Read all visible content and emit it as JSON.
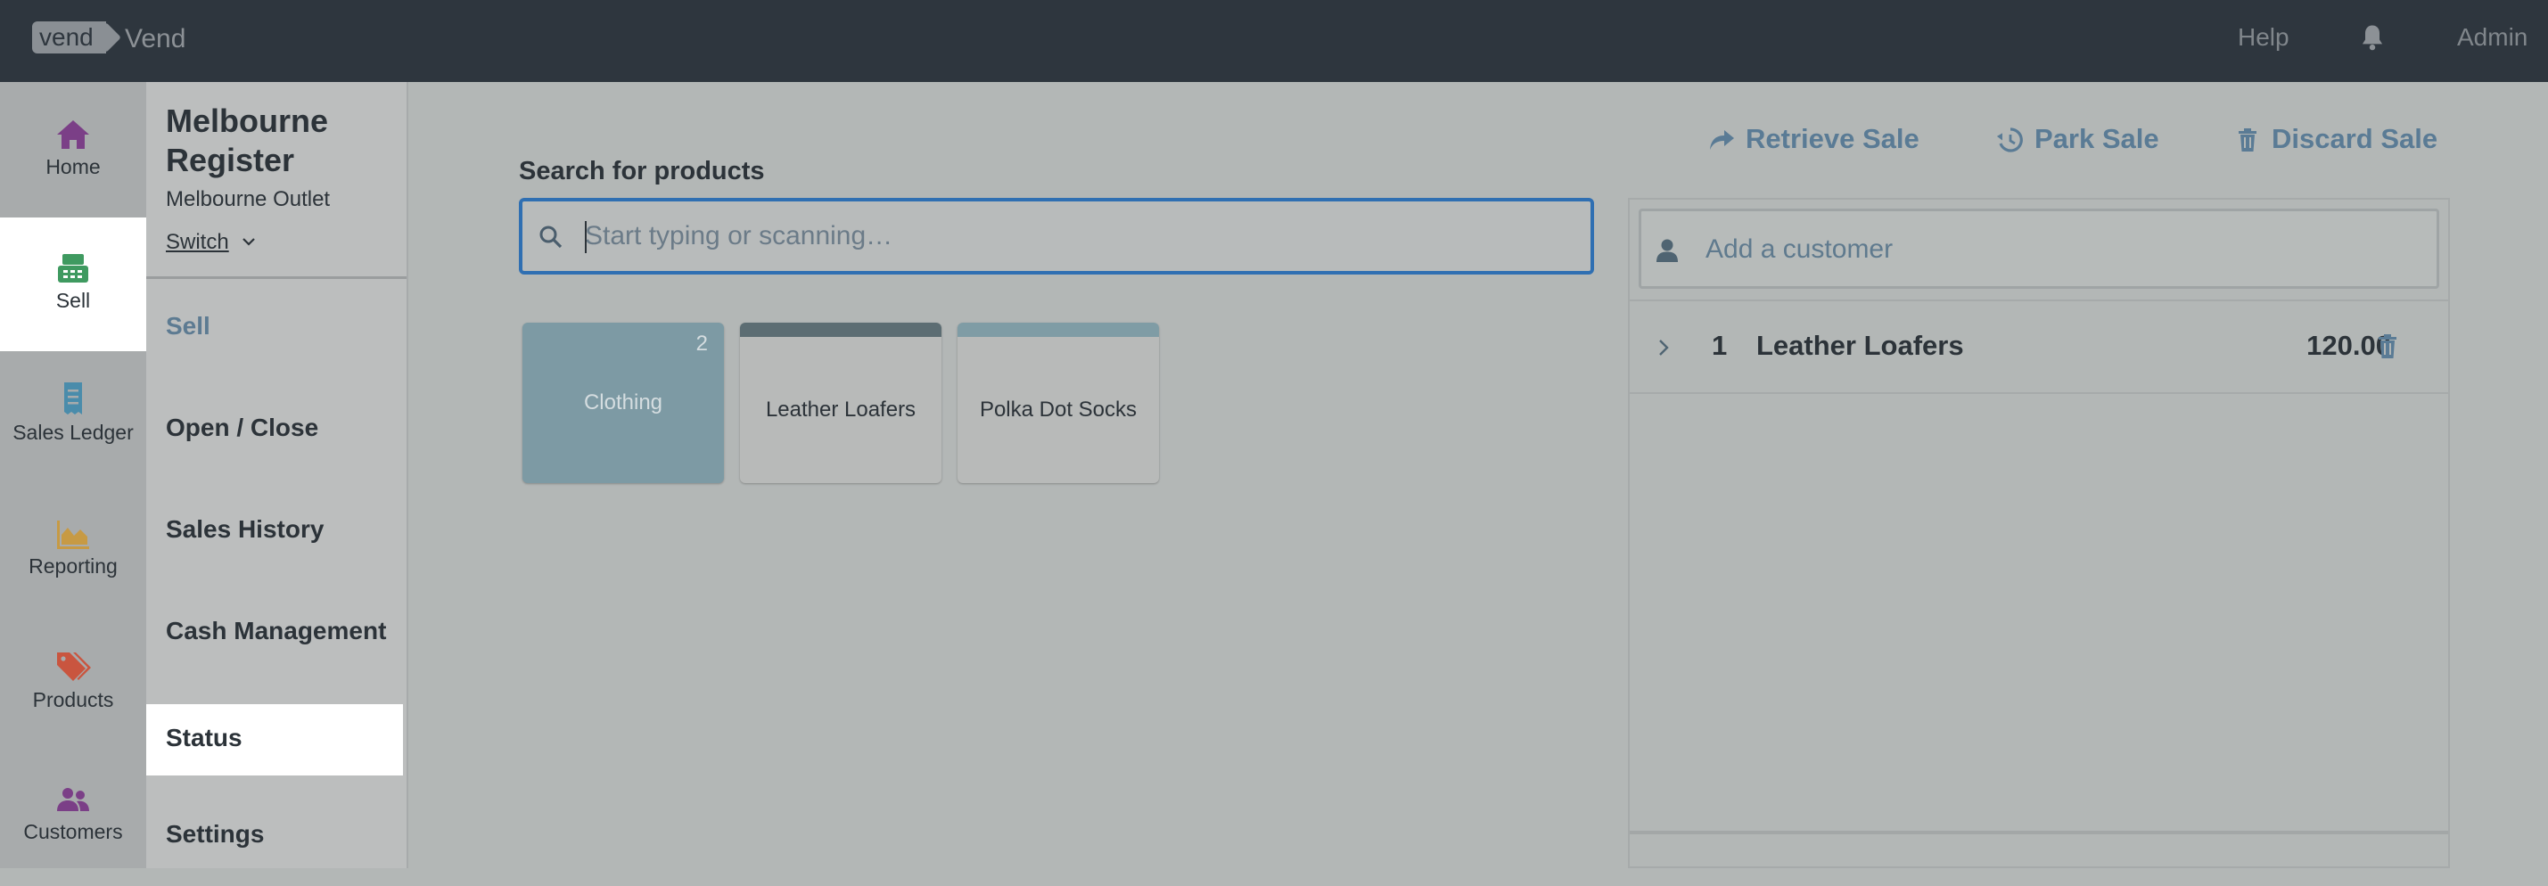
{
  "topbar": {
    "logo_text": "vend",
    "app_name": "Vend",
    "help": "Help",
    "user": "Admin",
    "bell_icon": "bell-icon"
  },
  "leftnav": {
    "items": [
      {
        "label": "Home",
        "icon": "home-icon",
        "color": "#7b3f87"
      },
      {
        "label": "Sell",
        "icon": "register-icon",
        "color": "#3f9a60",
        "active": true
      },
      {
        "label": "Sales Ledger",
        "icon": "receipt-icon",
        "color": "#4a8cab"
      },
      {
        "label": "Reporting",
        "icon": "area-chart-icon",
        "color": "#c79a44"
      },
      {
        "label": "Products",
        "icon": "tags-icon",
        "color": "#c9553f"
      },
      {
        "label": "Customers",
        "icon": "users-icon",
        "color": "#7b3f87"
      }
    ]
  },
  "register": {
    "title": "Melbourne Register",
    "outlet": "Melbourne Outlet",
    "switch_label": "Switch"
  },
  "subnav": {
    "items": [
      {
        "label": "Sell",
        "current": true
      },
      {
        "label": "Open / Close"
      },
      {
        "label": "Sales History"
      },
      {
        "label": "Cash Management"
      },
      {
        "label": "Status",
        "active": true
      },
      {
        "label": "Settings"
      }
    ]
  },
  "search": {
    "label": "Search for products",
    "placeholder": "Start typing or scanning…",
    "value": ""
  },
  "tiles": [
    {
      "name": "Clothing",
      "type": "folder",
      "count": "2",
      "color": "#7d9aa4"
    },
    {
      "name": "Leather Loafers",
      "type": "product",
      "bar_color": "#5c6d73"
    },
    {
      "name": "Polka Dot Socks",
      "type": "product",
      "bar_color": "#7f9ca5"
    }
  ],
  "actions": {
    "retrieve": "Retrieve Sale",
    "park": "Park Sale",
    "discard": "Discard Sale"
  },
  "sale": {
    "customer_placeholder": "Add a customer",
    "line_items": [
      {
        "qty": "1",
        "name": "Leather Loafers",
        "price": "120.00"
      }
    ]
  },
  "colors": {
    "accent": "#2f6fb2",
    "link": "#5a7b95",
    "topbar": "#2e363e"
  }
}
